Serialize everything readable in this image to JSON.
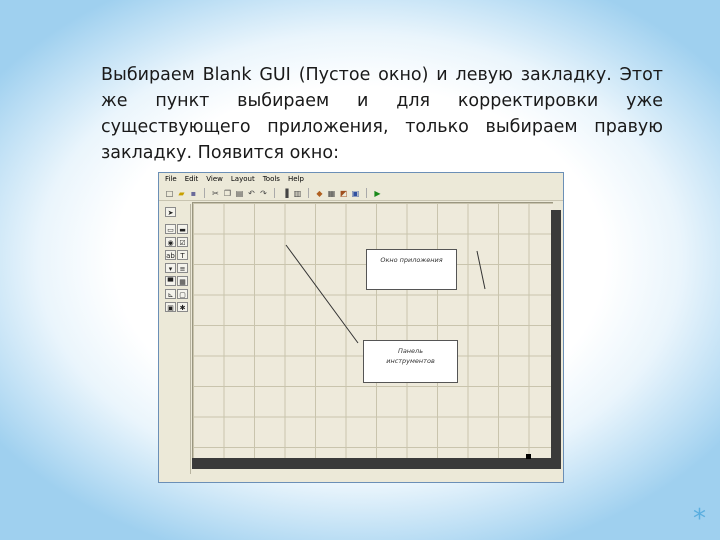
{
  "slide": {
    "paragraph": "Выбираем Blank GUI (Пустое окно) и левую закладку. Этот же пункт выбираем и для корректировки уже существующего приложения, только выбираем правую закладку. Появится окно:",
    "corner_mark": "*"
  },
  "window": {
    "menu": [
      "File",
      "Edit",
      "View",
      "Layout",
      "Tools",
      "Help"
    ],
    "toolbar_icons": [
      "new-icon",
      "open-icon",
      "save-icon",
      "cut-icon",
      "copy-icon",
      "paste-icon",
      "undo-icon",
      "redo-icon",
      "align-icon",
      "menu-editor-icon",
      "tab-order-icon",
      "mfile-editor-icon",
      "property-inspector-icon",
      "object-browser-icon",
      "run-icon"
    ],
    "palette_icons": [
      "select-arrow-icon",
      "push-button-icon",
      "slider-icon",
      "radio-button-icon",
      "checkbox-icon",
      "edit-text-icon",
      "static-text-icon",
      "popup-menu-icon",
      "listbox-icon",
      "toggle-button-icon",
      "table-icon",
      "axes-icon",
      "panel-icon",
      "button-group-icon",
      "activex-icon"
    ],
    "callouts": {
      "window_label": "Окно приложения",
      "toolbar_label_line1": "Панель",
      "toolbar_label_line2": "инструментов"
    }
  }
}
